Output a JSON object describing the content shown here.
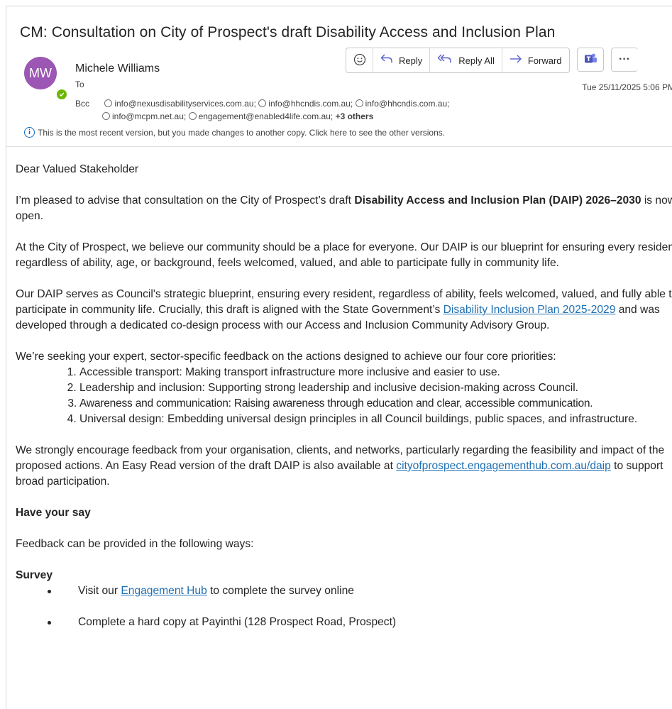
{
  "email": {
    "subject": "CM: Consultation on City of Prospect's draft Disability Access and Inclusion Plan",
    "sender": {
      "initials": "MW",
      "name": "Michele Williams",
      "avatar_color": "#9b57b3"
    },
    "to_label": "To",
    "date": "Tue 25/11/2025 5:06 PM",
    "bcc_label": "Bcc",
    "bcc_line1": [
      "info@nexusdisabilityservices.com.au;",
      "info@hhcndis.com.au;",
      "info@hhcndis.com.au;"
    ],
    "bcc_line2": [
      "info@mcpm.net.au;",
      "engagement@enabled4life.com.au;"
    ],
    "bcc_more": "+3 others",
    "info_text": "This is the most recent version, but you made changes to another copy. Click here to see the other versions."
  },
  "actions": {
    "emoji_icon": "smiley-icon",
    "reply": "Reply",
    "reply_all": "Reply All",
    "forward": "Forward",
    "more": "···"
  },
  "body": {
    "greeting": "Dear Valued Stakeholder",
    "p1_pre": "I’m pleased to advise that consultation on the City of Prospect’s draft ",
    "p1_bold": "Disability Access and Inclusion Plan (DAIP) 2026–2030",
    "p1_post": " is now open.",
    "p2": "At the City of Prospect, we believe our community should be a place for everyone. Our DAIP is our blueprint for ensuring every resident, regardless of ability, age, or background, feels welcomed, valued, and able to participate fully in community life.",
    "p3_pre": "Our DAIP serves as Council's strategic blueprint, ensuring every resident, regardless of ability, feels welcomed, valued, and fully able to participate in community life. Crucially, this draft is aligned with the State Government’s ",
    "p3_link": "Disability Inclusion Plan 2025-2029",
    "p3_post": " and was developed through a dedicated co-design process with our Access and Inclusion Community Advisory Group.",
    "p4": "We’re seeking your expert, sector-specific feedback on the actions designed to achieve our four core priorities:",
    "priorities": [
      "Accessible transport: Making transport infrastructure more inclusive and easier to use.",
      "Leadership and inclusion: Supporting strong leadership and inclusive decision-making across Council.",
      "Awareness and communication: Raising awareness through education and clear, accessible communication.",
      "Universal design: Embedding universal design principles in all Council buildings, public spaces, and infrastructure."
    ],
    "p5_pre": "We strongly encourage feedback from your organisation, clients, and networks, particularly regarding the feasibility and impact of the proposed actions. An Easy Read version of the draft DAIP is also available at ",
    "p5_link": "cityofprospect.engagementhub.com.au/daip",
    "p5_post": " to support broad participation.",
    "have_your_say": "Have your say",
    "feedback_intro": "Feedback can be provided in the following ways:",
    "survey_heading": "Survey",
    "survey_1_pre": "Visit our ",
    "survey_1_link": "Engagement Hub",
    "survey_1_post": " to complete the survey online",
    "survey_2": "Complete a hard copy at Payinthi (128 Prospect Road, Prospect)"
  },
  "colors": {
    "accent": "#5b5fc7",
    "link": "#1f6fb2",
    "presence": "#6bb700",
    "teams": "#4b53bc"
  }
}
